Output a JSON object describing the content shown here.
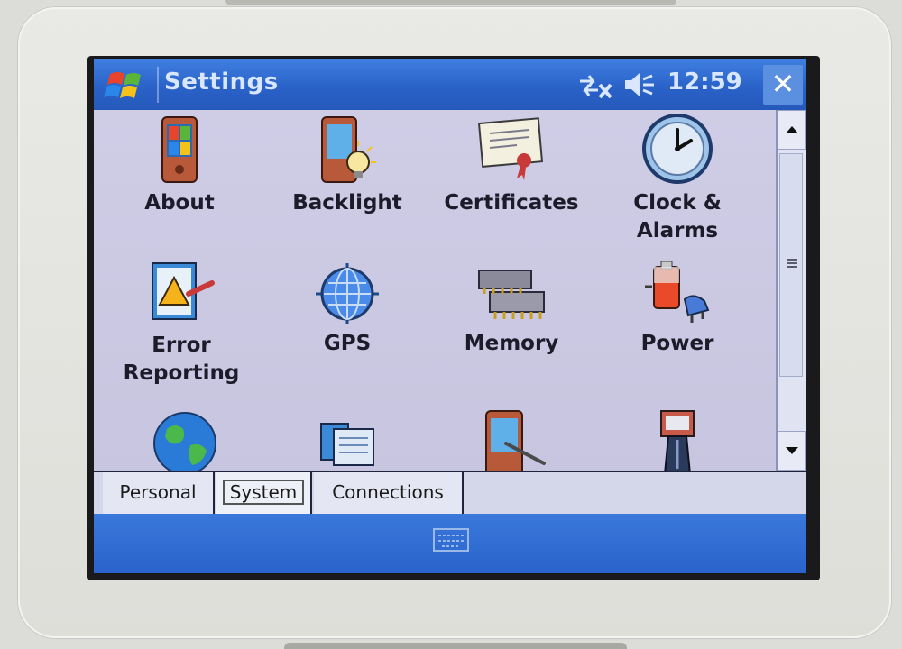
{
  "window": {
    "title": "Settings",
    "clock": "12:59",
    "close_label": "✕"
  },
  "settings_items": [
    {
      "label": "About",
      "icon": "pda-about-icon"
    },
    {
      "label": "Backlight",
      "icon": "backlight-icon"
    },
    {
      "label": "Certificates",
      "icon": "certificate-icon"
    },
    {
      "label": "Clock &\nAlarms",
      "icon": "clock-icon"
    },
    {
      "label": "Error\nReporting",
      "icon": "error-reporting-icon"
    },
    {
      "label": "GPS",
      "icon": "gps-globe-icon"
    },
    {
      "label": "Memory",
      "icon": "memory-icon"
    },
    {
      "label": "Power",
      "icon": "power-battery-icon"
    },
    {
      "label": "",
      "icon": "globe-icon"
    },
    {
      "label": "",
      "icon": "folders-icon"
    },
    {
      "label": "",
      "icon": "screen-stylus-icon"
    },
    {
      "label": "",
      "icon": "device-icon"
    }
  ],
  "tabs": [
    {
      "label": "Personal",
      "selected": false
    },
    {
      "label": "System",
      "selected": true
    },
    {
      "label": "Connections",
      "selected": false
    }
  ],
  "colors": {
    "titlebar": "#2a62c8",
    "content_bg": "#c7c5df",
    "label_text": "#1b1b2a"
  }
}
